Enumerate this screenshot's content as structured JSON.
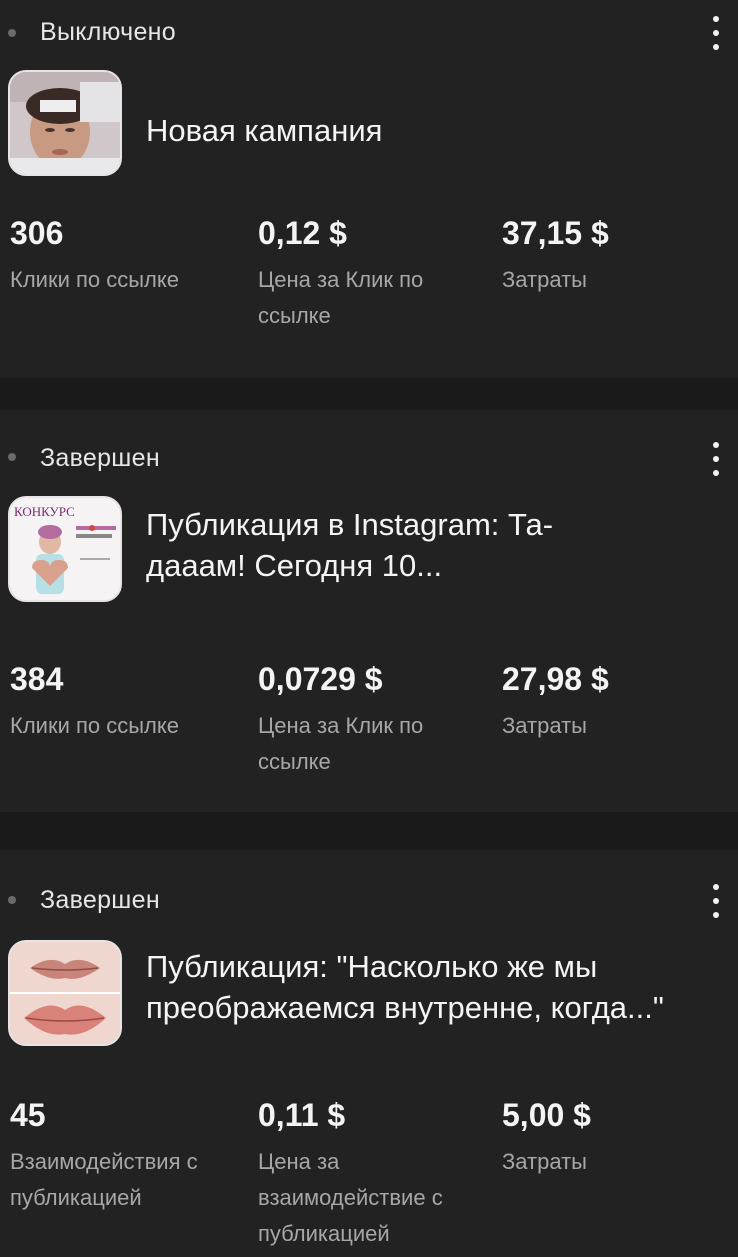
{
  "campaigns": [
    {
      "status": "Выключено",
      "title": "Новая кампания",
      "thumbnail_icon": "face-treatment-photo",
      "metrics": [
        {
          "value": "306",
          "label": "Клики по ссылке"
        },
        {
          "value": "0,12 $",
          "label": "Цена за Клик по ссылке"
        },
        {
          "value": "37,15 $",
          "label": "Затраты"
        }
      ]
    },
    {
      "status": "Завершен",
      "title": "Публикация в Instagram: Та-дааам! Сегодня 10...",
      "thumbnail_icon": "contest-poster",
      "thumbnail_text": "КОНКУРС",
      "metrics": [
        {
          "value": "384",
          "label": "Клики по ссылке"
        },
        {
          "value": "0,0729 $",
          "label": "Цена за Клик по ссылке"
        },
        {
          "value": "27,98 $",
          "label": "Затраты"
        }
      ]
    },
    {
      "status": "Завершен",
      "title": "Публикация: \"Насколько же мы преображаемся внутренне, когда...\"",
      "thumbnail_icon": "lips-before-after-photo",
      "metrics": [
        {
          "value": "45",
          "label": "Взаимодействия с публикацией"
        },
        {
          "value": "0,11 $",
          "label": "Цена за взаимодействие с публикацией"
        },
        {
          "value": "5,00 $",
          "label": "Затраты"
        }
      ]
    }
  ],
  "colors": {
    "background": "#1a1a1b",
    "card": "#222223",
    "status_dot": "#6b6b6d",
    "label": "#a7a7a9"
  }
}
